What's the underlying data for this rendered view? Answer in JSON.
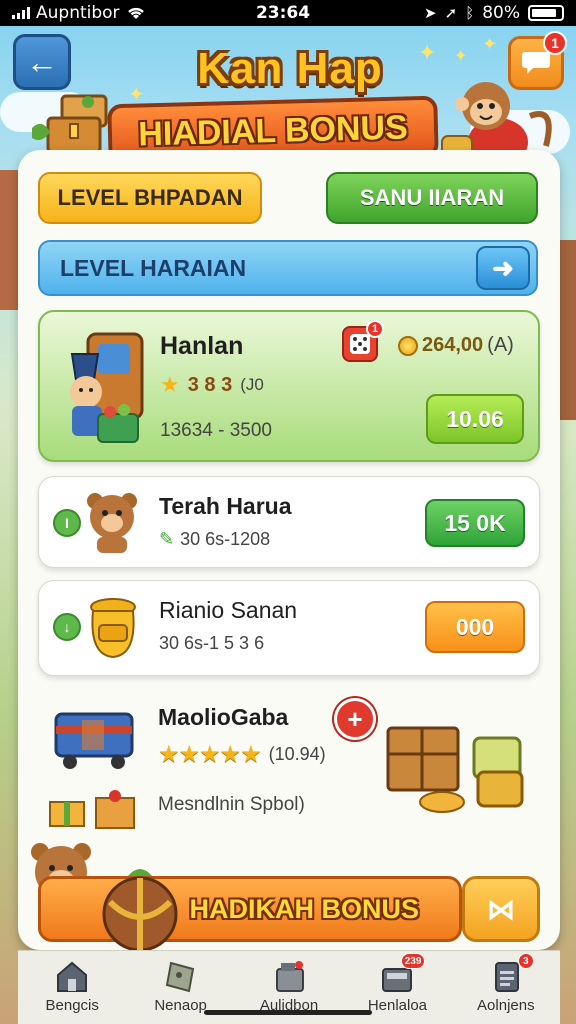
{
  "status_bar": {
    "carrier": "Aupntibor",
    "time": "23:64",
    "battery": "80%"
  },
  "header": {
    "title": "Kan Hap",
    "banner": "HIADIAL BONUS",
    "chat_badge": "1"
  },
  "tabs": {
    "left": "LEVEL BHPADAN",
    "right": "SANU IIARAN"
  },
  "level_bar": {
    "label": "LEVEL HARAIAN"
  },
  "offers": [
    {
      "name": "Hanlan",
      "rating_text": "3 8 3",
      "rating_note": "(J0",
      "range": "13634 - 3500",
      "coin_price": "264,00",
      "coin_note": "(A)",
      "dice_badge": "1",
      "button": "10.06"
    },
    {
      "name": "Terah Harua",
      "range": "30 6s-1208",
      "side_icon": "I",
      "button": "15 0K"
    },
    {
      "name": "Rianio Sanan",
      "range": "30 6s-1 5 3 6",
      "side_icon": "↓",
      "button": "000"
    },
    {
      "name": "MaolioGaba",
      "rating_note": "(10.94)",
      "subtitle": "Mesndlnin Spbol)"
    }
  ],
  "bonus": {
    "label": "HADIKAH BONUS"
  },
  "tab_bar": [
    {
      "label": "Bengcis",
      "icon": "home-icon"
    },
    {
      "label": "Nenaop",
      "icon": "coupon-icon"
    },
    {
      "label": "Aulidbon",
      "icon": "shop-icon"
    },
    {
      "label": "Henlaloa",
      "icon": "cash-register-icon",
      "badge": "239"
    },
    {
      "label": "Aolnjens",
      "icon": "clipboard-icon",
      "badge": "3"
    }
  ],
  "colors": {
    "accent_orange": "#f07a1a",
    "accent_green": "#3fa52c",
    "accent_blue": "#4fb2ec",
    "title_gold": "#ffc21f"
  }
}
